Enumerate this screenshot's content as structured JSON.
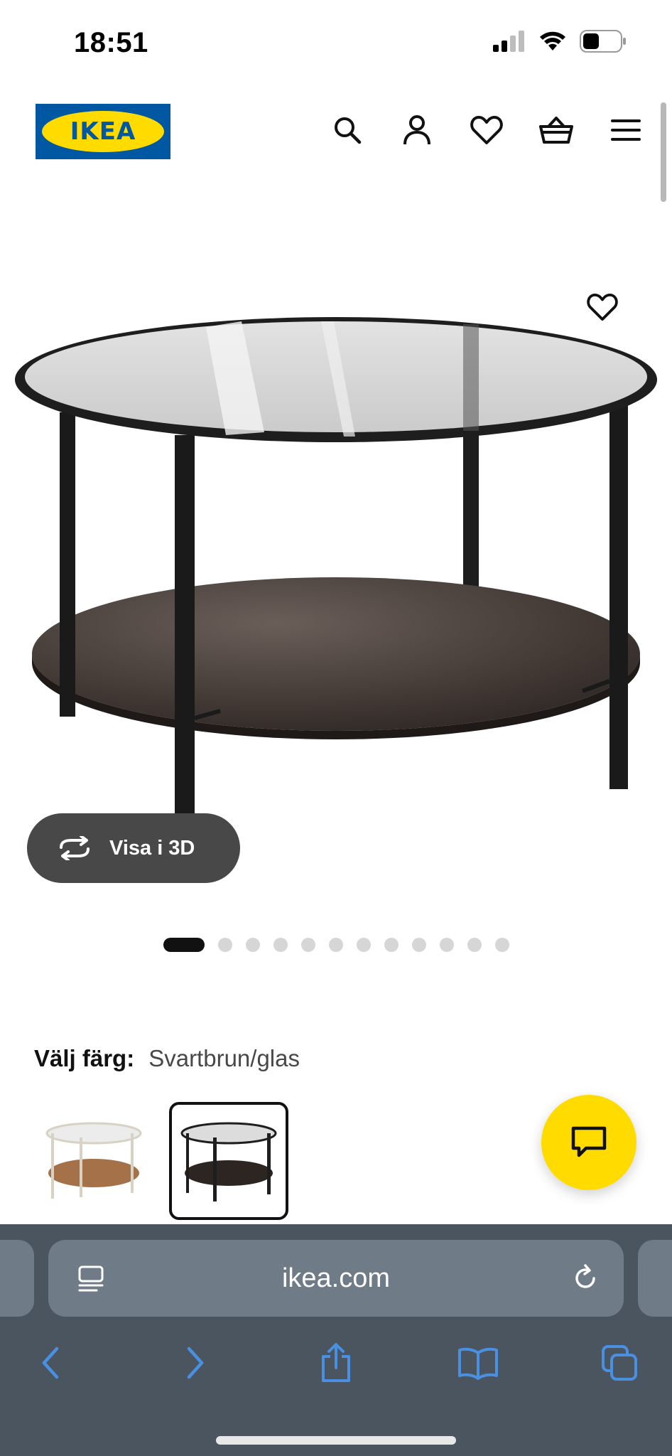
{
  "status_bar": {
    "time": "18:51"
  },
  "header": {
    "logo_text": "IKEA",
    "icons": [
      "search-icon",
      "account-icon",
      "heart-icon",
      "basket-icon",
      "menu-icon"
    ]
  },
  "product": {
    "view_3d_label": "Visa i 3D",
    "carousel": {
      "total_images": 12,
      "active_index": 0
    }
  },
  "color_picker": {
    "label": "Välj färg:",
    "selected_value": "Svartbrun/glas",
    "options": [
      "walnut-white-option",
      "black-brown-glass-option"
    ],
    "selected_option_index": 1
  },
  "browser": {
    "address": "ikea.com",
    "toolbar_icons": [
      "back-icon",
      "forward-icon",
      "share-icon",
      "bookmarks-icon",
      "tabs-icon"
    ]
  },
  "colors": {
    "ikea_blue": "#0058a3",
    "ikea_yellow": "#ffdb00",
    "safari_blue": "#4a90e2"
  }
}
